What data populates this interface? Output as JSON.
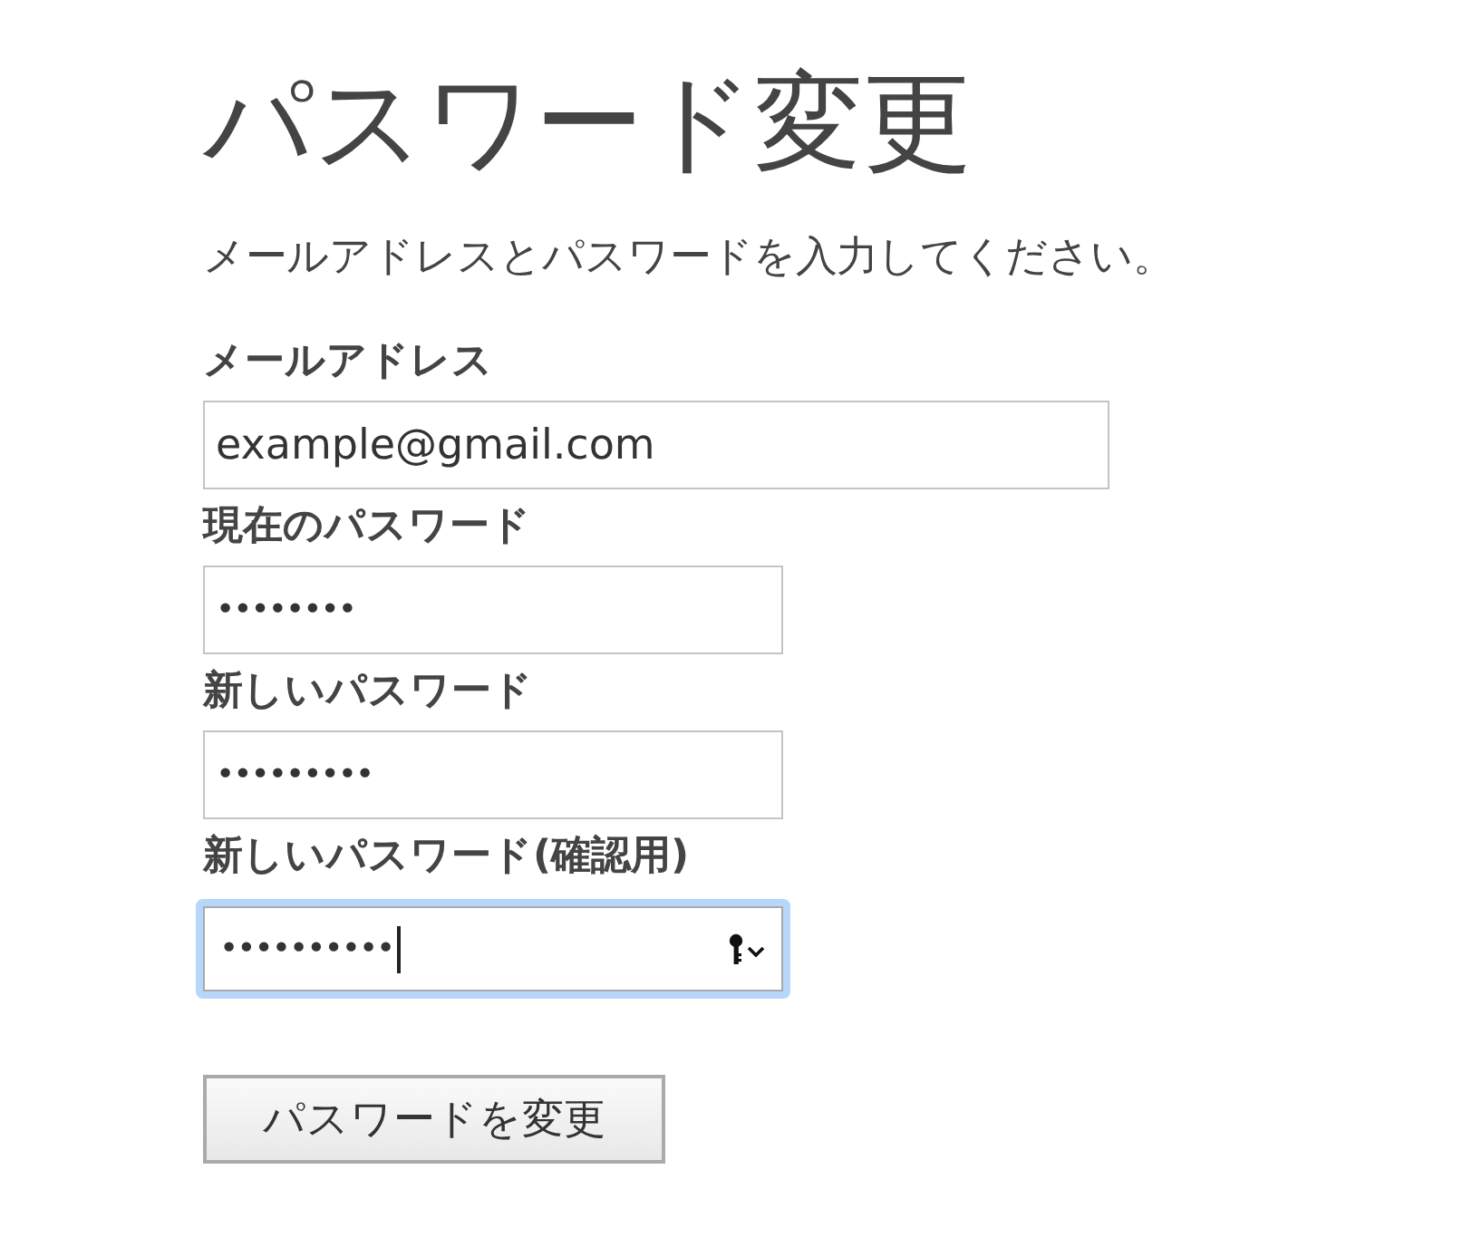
{
  "title": "パスワード変更",
  "instruction": "メールアドレスとパスワードを入力してください。",
  "fields": [
    {
      "label": "メールアドレス",
      "kind": "email",
      "value": "example@gmail.com",
      "focused": false
    },
    {
      "label": "現在のパスワード",
      "kind": "password",
      "value": "••••••••",
      "focused": false
    },
    {
      "label": "新しいパスワード",
      "kind": "password",
      "value": "•••••••••",
      "focused": false
    },
    {
      "label": "新しいパスワード(確認用)",
      "kind": "password",
      "value": "••••••••••",
      "focused": true
    }
  ],
  "submit": {
    "label": "パスワードを変更"
  }
}
